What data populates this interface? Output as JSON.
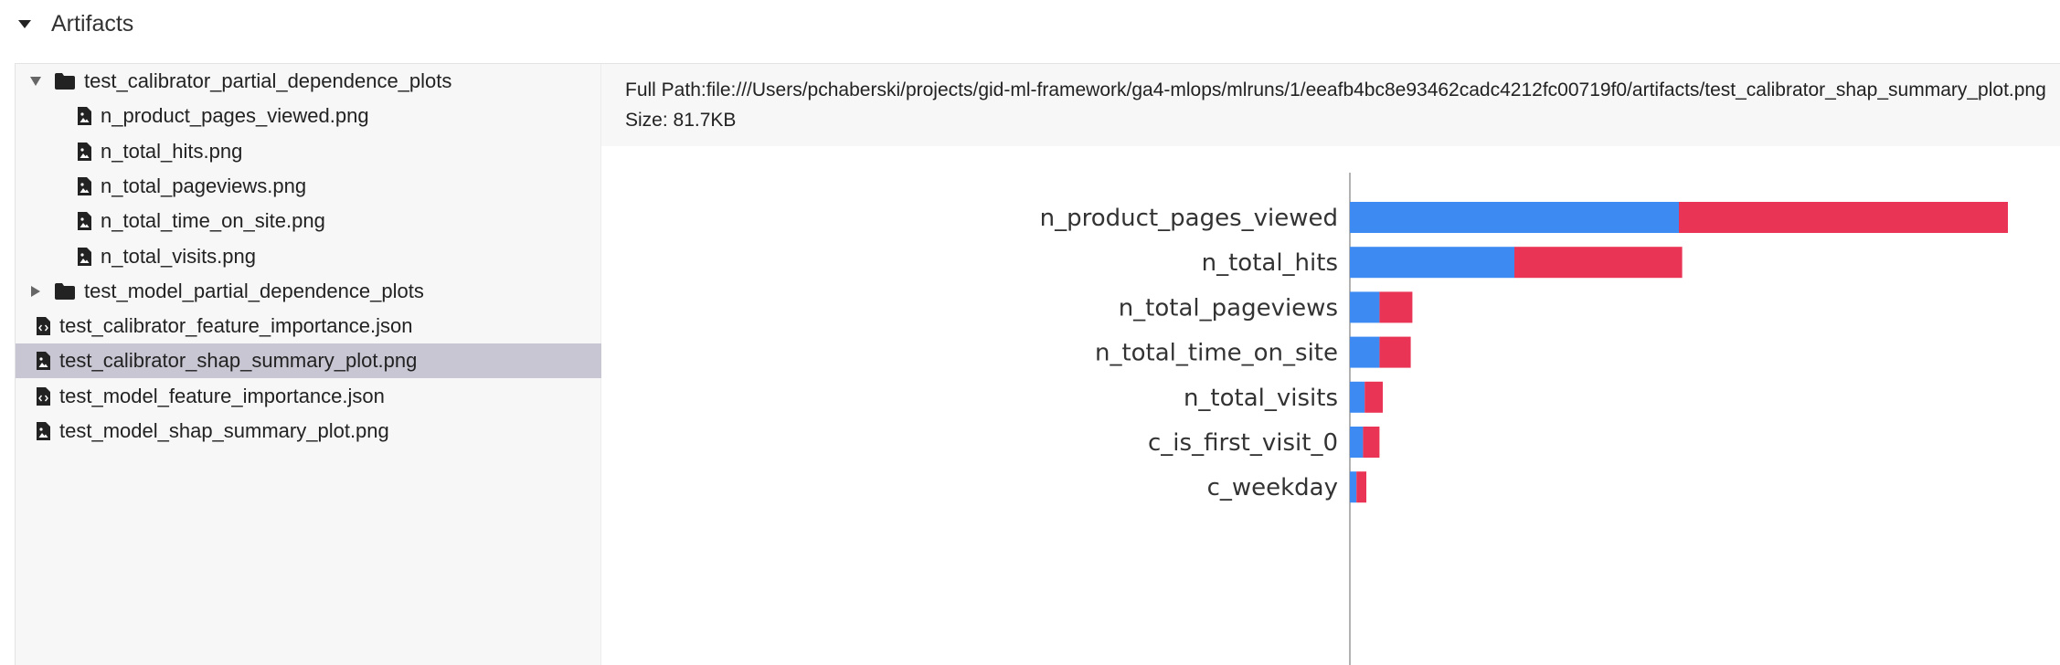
{
  "section": {
    "title": "Artifacts"
  },
  "tree": {
    "items": [
      {
        "label": "test_calibrator_partial_dependence_plots",
        "type": "folder",
        "state": "expanded",
        "depth": 0
      },
      {
        "label": "n_product_pages_viewed.png",
        "type": "image",
        "depth": 1
      },
      {
        "label": "n_total_hits.png",
        "type": "image",
        "depth": 1
      },
      {
        "label": "n_total_pageviews.png",
        "type": "image",
        "depth": 1
      },
      {
        "label": "n_total_time_on_site.png",
        "type": "image",
        "depth": 1
      },
      {
        "label": "n_total_visits.png",
        "type": "image",
        "depth": 1
      },
      {
        "label": "test_model_partial_dependence_plots",
        "type": "folder",
        "state": "collapsed",
        "depth": 0
      },
      {
        "label": "test_calibrator_feature_importance.json",
        "type": "code",
        "depth": 0
      },
      {
        "label": "test_calibrator_shap_summary_plot.png",
        "type": "image",
        "depth": 0,
        "selected": true
      },
      {
        "label": "test_model_feature_importance.json",
        "type": "code",
        "depth": 0
      },
      {
        "label": "test_model_shap_summary_plot.png",
        "type": "image",
        "depth": 0
      }
    ]
  },
  "preview": {
    "full_path": "Full Path:file:///Users/pchaberski/projects/gid-ml-framework/ga4-mlops/mlruns/1/eeafb4bc8e93462cadc4212fc00719f0/artifacts/test_calibrator_shap_summary_plot.png",
    "size": "Size: 81.7KB"
  },
  "colors": {
    "series_a": "#3d8bf2",
    "series_b": "#ea3455",
    "selected_row": "#c9c6d3"
  },
  "chart_data": {
    "type": "bar",
    "orientation": "horizontal",
    "stacked": true,
    "categories": [
      "n_product_pages_viewed",
      "n_total_hits",
      "n_total_pageviews",
      "n_total_time_on_site",
      "n_total_visits",
      "c_is_first_visit_0",
      "c_weekday"
    ],
    "series": [
      {
        "values": [
          1.0,
          0.5,
          0.09,
          0.09,
          0.045,
          0.04,
          0.02
        ]
      },
      {
        "values": [
          1.0,
          0.51,
          0.1,
          0.095,
          0.055,
          0.05,
          0.03
        ]
      }
    ],
    "xlim": [
      0,
      2.2
    ],
    "title": "",
    "xlabel": "",
    "ylabel": ""
  }
}
